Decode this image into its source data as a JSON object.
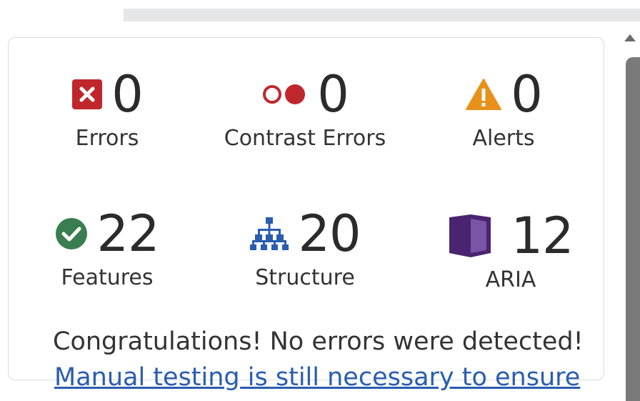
{
  "summary": {
    "errors": {
      "count": "0",
      "label": "Errors",
      "icon": "error-icon",
      "color": "#c0272d"
    },
    "contrast": {
      "count": "0",
      "label": "Contrast Errors",
      "icon": "contrast-icon",
      "color": "#c0272d"
    },
    "alerts": {
      "count": "0",
      "label": "Alerts",
      "icon": "alert-icon",
      "color": "#e8911a"
    },
    "features": {
      "count": "22",
      "label": "Features",
      "icon": "checkmark-icon",
      "color": "#3a7d51"
    },
    "structure": {
      "count": "20",
      "label": "Structure",
      "icon": "structure-icon",
      "color": "#2a5db0"
    },
    "aria": {
      "count": "12",
      "label": "ARIA",
      "icon": "aria-icon",
      "color": "#4a2470"
    }
  },
  "message": "Congratulations! No errors were detected!",
  "link_text": "Manual testing is still necessary to ensure"
}
